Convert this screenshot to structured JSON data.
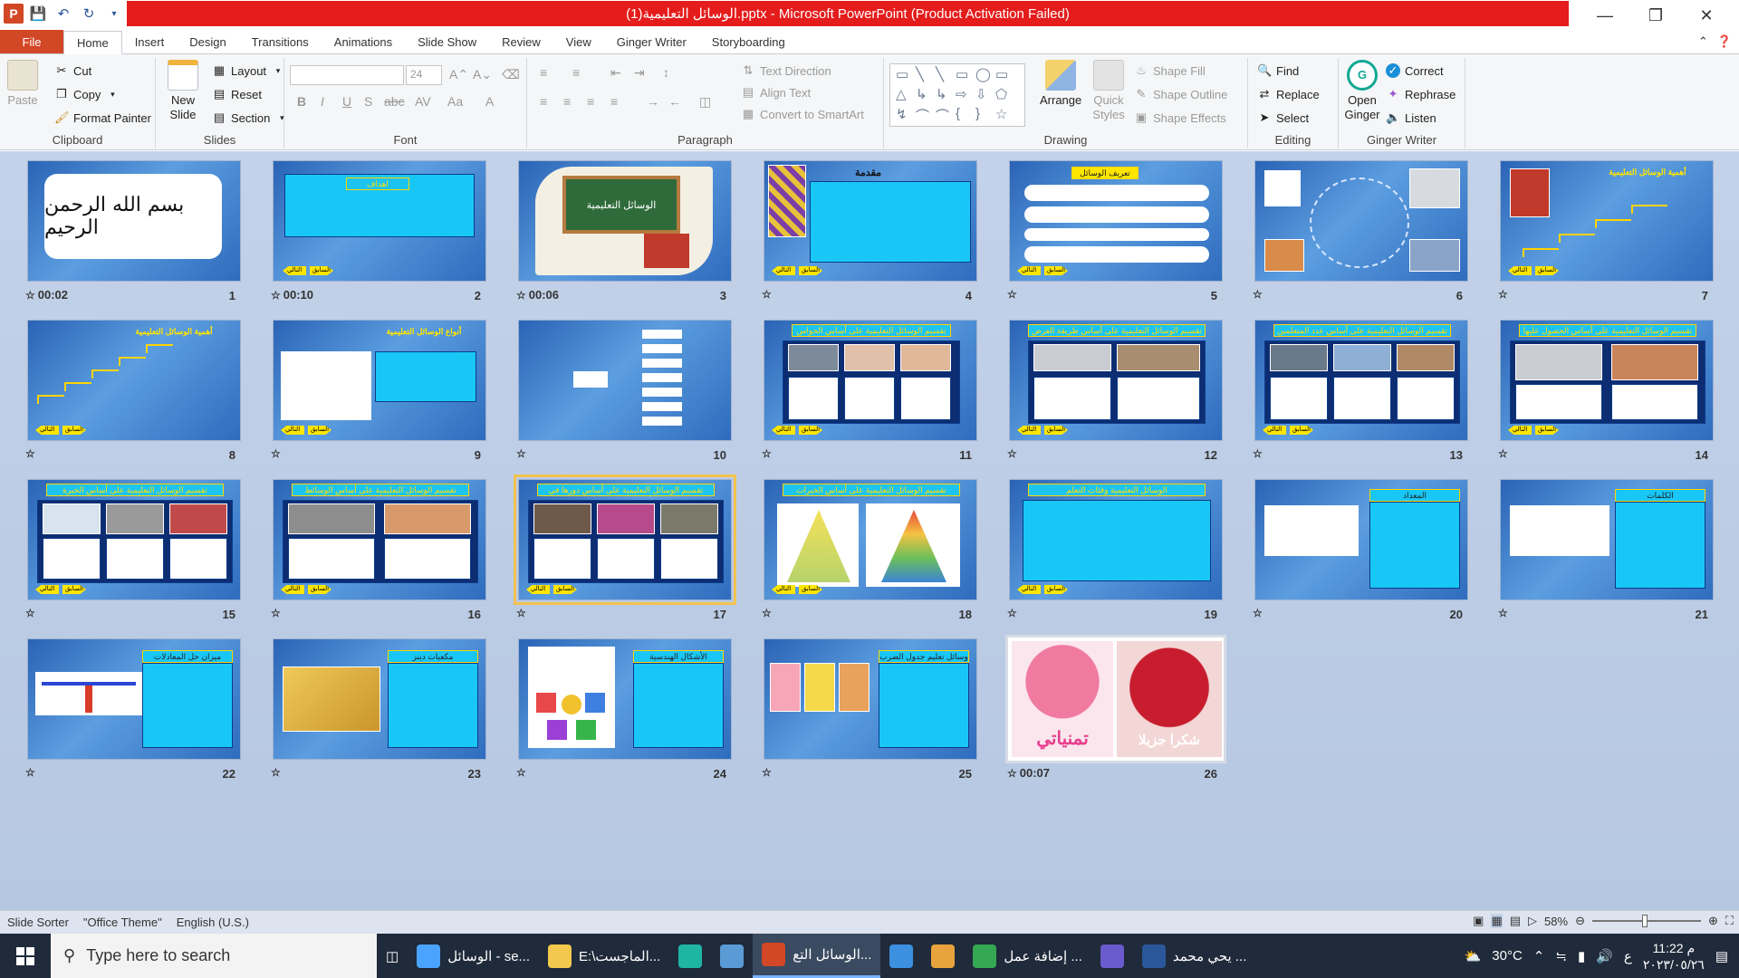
{
  "window": {
    "title": "الوسائل التعليمية(1).pptx - Microsoft PowerPoint (Product Activation Failed)",
    "app_icon_letter": "P"
  },
  "tabs": [
    "File",
    "Home",
    "Insert",
    "Design",
    "Transitions",
    "Animations",
    "Slide Show",
    "Review",
    "View",
    "Ginger Writer",
    "Storyboarding"
  ],
  "active_tab": "Home",
  "ribbon": {
    "clipboard": {
      "label": "Clipboard",
      "paste": "Paste",
      "cut": "Cut",
      "copy": "Copy",
      "format_painter": "Format Painter"
    },
    "slides": {
      "label": "Slides",
      "new_slide": "New Slide",
      "layout": "Layout",
      "reset": "Reset",
      "section": "Section"
    },
    "font": {
      "label": "Font",
      "font_name": "",
      "font_size": "24"
    },
    "paragraph": {
      "label": "Paragraph",
      "text_direction": "Text Direction",
      "align_text": "Align Text",
      "convert_smartart": "Convert to SmartArt"
    },
    "drawing": {
      "label": "Drawing",
      "arrange": "Arrange",
      "quick_styles": "Quick Styles",
      "shape_fill": "Shape Fill",
      "shape_outline": "Shape Outline",
      "shape_effects": "Shape Effects"
    },
    "editing": {
      "label": "Editing",
      "find": "Find",
      "replace": "Replace",
      "select": "Select"
    },
    "ginger": {
      "label": "Ginger Writer",
      "open_ginger": "Open Ginger",
      "correct": "Correct",
      "rephrase": "Rephrase",
      "listen": "Listen"
    }
  },
  "slides": [
    {
      "num": "1",
      "timing": "00:02",
      "title": ""
    },
    {
      "num": "2",
      "timing": "00:10",
      "title": "اهداف"
    },
    {
      "num": "3",
      "timing": "00:06",
      "title": "الوسائل التعليمية"
    },
    {
      "num": "4",
      "timing": "",
      "title": "مقدمة"
    },
    {
      "num": "5",
      "timing": "",
      "title": "تعريف الوسائل التعليمية"
    },
    {
      "num": "6",
      "timing": "",
      "title": ""
    },
    {
      "num": "7",
      "timing": "",
      "title": "أهمية الوسائل التعليمية"
    },
    {
      "num": "8",
      "timing": "",
      "title": "أهمية الوسائل التعليمية"
    },
    {
      "num": "9",
      "timing": "",
      "title": "أنواع الوسائل التعليمية"
    },
    {
      "num": "10",
      "timing": "",
      "title": ""
    },
    {
      "num": "11",
      "timing": "",
      "title": "تقسيم الوسائل التعليمية على أساس الحواس"
    },
    {
      "num": "12",
      "timing": "",
      "title": "تقسيم الوسائل التعليمية على أساس طريقة العرض"
    },
    {
      "num": "13",
      "timing": "",
      "title": "تقسيم الوسائل التعليمية على أساس عدد المتعلمين"
    },
    {
      "num": "14",
      "timing": "",
      "title": "تقسيم الوسائل التعليمية على أساس الحصول عليها"
    },
    {
      "num": "15",
      "timing": "",
      "title": "تقسيم الوسائل التعليمية على أساس الخبرة"
    },
    {
      "num": "16",
      "timing": "",
      "title": "تقسيم الوسائل التعليمية على أساس الوسائط"
    },
    {
      "num": "17",
      "timing": "",
      "title": "تقسيم الوسائل التعليمية على أساس دورها في العملية التعليمية"
    },
    {
      "num": "18",
      "timing": "",
      "title": "تقسيم الوسائل التعليمية على أساس الخبرات المباشرة"
    },
    {
      "num": "19",
      "timing": "",
      "title": "الوسائل التعليمية وفئات التعلم"
    },
    {
      "num": "20",
      "timing": "",
      "title": "المعداد"
    },
    {
      "num": "21",
      "timing": "",
      "title": "الكلمات"
    },
    {
      "num": "22",
      "timing": "",
      "title": "ميزان حل المعادلات"
    },
    {
      "num": "23",
      "timing": "",
      "title": "مكعبات دينز"
    },
    {
      "num": "24",
      "timing": "",
      "title": "الأشكال الهندسية المجسمة"
    },
    {
      "num": "25",
      "timing": "",
      "title": "وسائل تعليم جدول الضرب"
    },
    {
      "num": "26",
      "timing": "00:07",
      "title": "شكرا جزيلا"
    }
  ],
  "thumb_labels": {
    "next": "التالي",
    "prev": "السابق",
    "bismillah": "بسم الله الرحمن الرحيم",
    "thanks": "شكرا جزيلا",
    "wishes": "تمنياتي"
  },
  "status": {
    "view": "Slide Sorter",
    "theme": "\"Office Theme\"",
    "language": "English (U.S.)",
    "zoom": "58%",
    "zoom_level": 0.58
  },
  "taskbar": {
    "search_placeholder": "Type here to search",
    "items": [
      {
        "label": "الوسائل - se...",
        "icon": "app-icon",
        "color": "#4aa3ff"
      },
      {
        "label": "E:\\الماجست...",
        "icon": "folder-icon",
        "color": "#f2c94c"
      },
      {
        "label": "",
        "icon": "edge-icon",
        "color": "#1fb5a5"
      },
      {
        "label": "",
        "icon": "store-icon",
        "color": "#5b9bd5"
      },
      {
        "label": "الوسائل التع...",
        "icon": "powerpoint-icon",
        "color": "#d24726"
      },
      {
        "label": "",
        "icon": "mail-icon",
        "color": "#3d8fe0"
      },
      {
        "label": "",
        "icon": "paint-icon",
        "color": "#e8a33c"
      },
      {
        "label": "إضافة عمل ...",
        "icon": "chrome-icon",
        "color": "#34a853"
      },
      {
        "label": "",
        "icon": "app2-icon",
        "color": "#6a5acd"
      },
      {
        "label": "يحي محمد ...",
        "icon": "word-icon",
        "color": "#2b579a"
      }
    ],
    "temperature": "30°C",
    "language": "ع",
    "time": "11:22 م",
    "date": "٢٠٢٣/٠٥/٢٦"
  }
}
